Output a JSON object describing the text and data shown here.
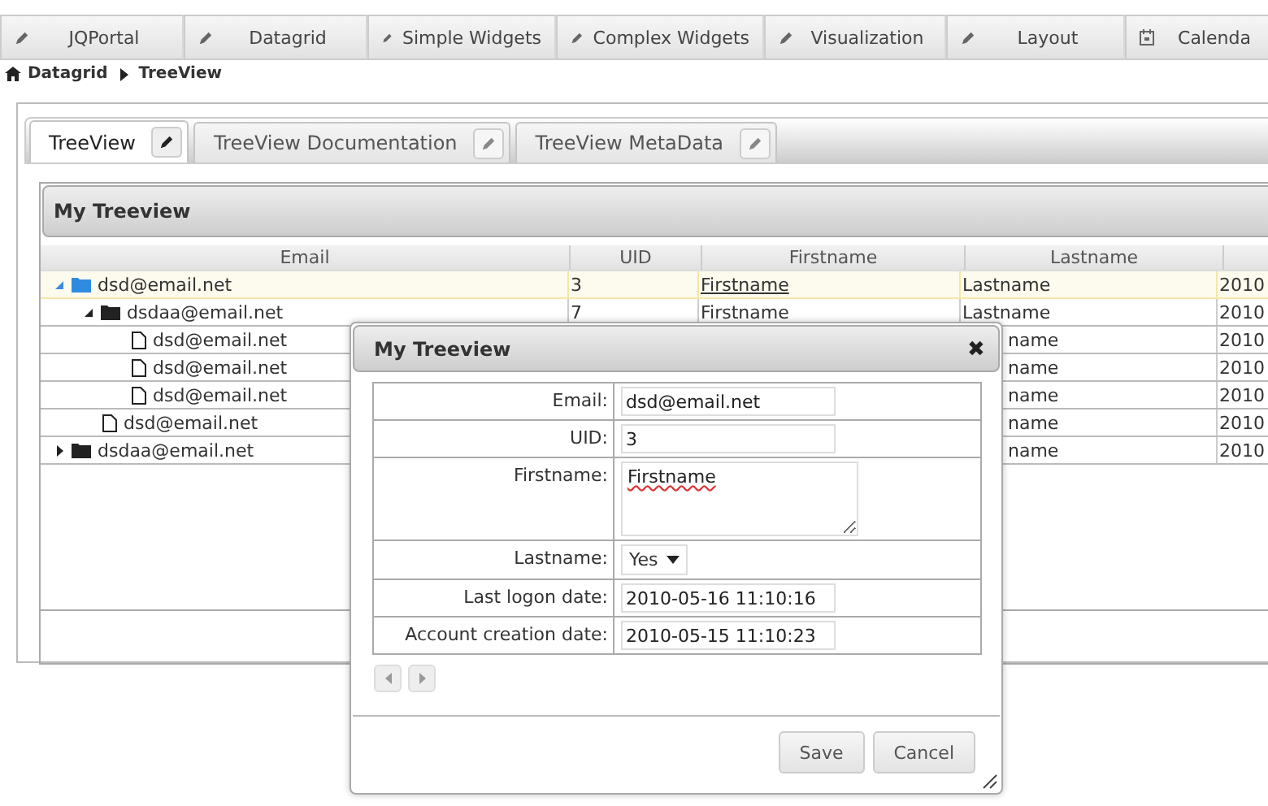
{
  "nav_tabs": [
    {
      "label": "JQPortal"
    },
    {
      "label": "Datagrid"
    },
    {
      "label": "Simple Widgets"
    },
    {
      "label": "Complex Widgets"
    },
    {
      "label": "Visualization"
    },
    {
      "label": "Layout"
    },
    {
      "label": "Calenda"
    }
  ],
  "breadcrumb": [
    "Datagrid",
    "TreeView"
  ],
  "page_tabs": [
    {
      "label": "TreeView",
      "selected": true
    },
    {
      "label": "TreeView Documentation",
      "selected": false
    },
    {
      "label": "TreeView MetaData",
      "selected": false
    }
  ],
  "grid": {
    "title": "My Treeview",
    "columns": [
      "Email",
      "UID",
      "Firstname",
      "Lastname"
    ],
    "rows": [
      {
        "kind": "folder",
        "email": "dsd@email.net",
        "uid": "3",
        "firstname": "Firstname",
        "lastname": "Lastname",
        "column_5": "2010",
        "selected": true,
        "expanded": true,
        "children": [
          {
            "kind": "folder",
            "email": "dsdaa@email.net",
            "uid": "7",
            "firstname": "Firstname",
            "lastname": "Lastname",
            "column_5": "2010",
            "selected": false,
            "expanded": true,
            "children": [
              {
                "kind": "file",
                "email": "dsd@email.net",
                "lastname": "name",
                "column_5": "2010",
                "selected": false
              },
              {
                "kind": "file",
                "email": "dsd@email.net",
                "lastname": "name",
                "column_5": "2010",
                "selected": false
              },
              {
                "kind": "file",
                "email": "dsd@email.net",
                "lastname": "name",
                "column_5": "2010",
                "selected": false
              }
            ]
          },
          {
            "kind": "file",
            "email": "dsd@email.net",
            "lastname": "name",
            "column_5": "2010",
            "selected": false
          }
        ]
      },
      {
        "kind": "folder",
        "email": "dsdaa@email.net",
        "lastname": "name",
        "column_5": "2010",
        "selected": false,
        "expanded": false
      }
    ]
  },
  "dialog": {
    "title": "My Treeview",
    "close": "✖",
    "fields": [
      {
        "kind": "input",
        "label": "Email:",
        "value": "dsd@email.net"
      },
      {
        "kind": "input",
        "label": "UID:",
        "value": "3"
      },
      {
        "kind": "textarea",
        "label": "Firstname:",
        "value": "Firstname"
      },
      {
        "kind": "select",
        "label": "Lastname:",
        "value": "Yes"
      },
      {
        "kind": "input",
        "label": "Last logon date:",
        "value": "2010-05-16 11:10:16"
      },
      {
        "kind": "input",
        "label": "Account creation date:",
        "value": "2010-05-15 11:10:23"
      }
    ],
    "buttons": [
      "Save",
      "Cancel"
    ]
  }
}
